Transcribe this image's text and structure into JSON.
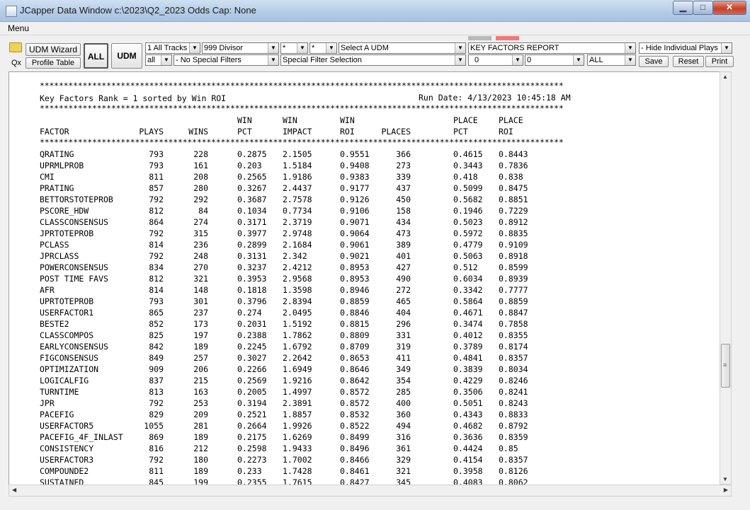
{
  "window": {
    "title": "JCapper Data Window c:\\2023\\Q2_2023 Odds Cap: None",
    "minimize": "▁",
    "maximize": "□",
    "close": "✕"
  },
  "menu": {
    "label": "Menu"
  },
  "toolbar": {
    "qx": "Qx",
    "udm_wizard": "UDM Wizard",
    "profile_table": "Profile Table",
    "all_button": "ALL",
    "udm_button": "UDM",
    "tracks": "1 All Tracks",
    "divisor": "999 Divisor",
    "star1": "*",
    "star2": "*",
    "select_udm": "Select A UDM",
    "report": "KEY FACTORS REPORT",
    "hide_plays": "- Hide Individual Plays",
    "all_lower": "all",
    "no_special": "- No Special Filters",
    "special_filter": "Special Filter Selection",
    "zero1": "0",
    "zero2": "0",
    "all_caps": "ALL",
    "save": "Save",
    "reset": "Reset",
    "print": "Print"
  },
  "report": {
    "stars": "**************************************************************************************************************",
    "heading": "Key Factors Rank = 1 sorted by Win ROI",
    "run_date": "Run Date: 4/13/2023 10:45:18 AM",
    "headers_top": [
      "",
      "",
      "",
      "WIN",
      "WIN",
      "WIN",
      "",
      "PLACE",
      "PLACE"
    ],
    "headers_bottom": [
      "FACTOR",
      "PLAYS",
      "WINS",
      "PCT",
      "IMPACT",
      "ROI",
      "PLACES",
      "PCT",
      "ROI"
    ],
    "rows": [
      [
        "QRATING",
        "793",
        "228",
        "0.2875",
        "2.1505",
        "0.9551",
        "366",
        "0.4615",
        "0.8443"
      ],
      [
        "UPRMLPROB",
        "793",
        "161",
        "0.203",
        "1.5184",
        "0.9408",
        "273",
        "0.3443",
        "0.7836"
      ],
      [
        "CMI",
        "811",
        "208",
        "0.2565",
        "1.9186",
        "0.9383",
        "339",
        "0.418",
        "0.838"
      ],
      [
        "PRATING",
        "857",
        "280",
        "0.3267",
        "2.4437",
        "0.9177",
        "437",
        "0.5099",
        "0.8475"
      ],
      [
        "BETTORSTOTEPROB",
        "792",
        "292",
        "0.3687",
        "2.7578",
        "0.9126",
        "450",
        "0.5682",
        "0.8851"
      ],
      [
        "PSCORE_HDW",
        "812",
        "84",
        "0.1034",
        "0.7734",
        "0.9106",
        "158",
        "0.1946",
        "0.7229"
      ],
      [
        "CLASSCONSENSUS",
        "864",
        "274",
        "0.3171",
        "2.3719",
        "0.9071",
        "434",
        "0.5023",
        "0.8912"
      ],
      [
        "JPRTOTEPROB",
        "792",
        "315",
        "0.3977",
        "2.9748",
        "0.9064",
        "473",
        "0.5972",
        "0.8835"
      ],
      [
        "PCLASS",
        "814",
        "236",
        "0.2899",
        "2.1684",
        "0.9061",
        "389",
        "0.4779",
        "0.9109"
      ],
      [
        "JPRCLASS",
        "792",
        "248",
        "0.3131",
        "2.342",
        "0.9021",
        "401",
        "0.5063",
        "0.8918"
      ],
      [
        "POWERCONSENSUS",
        "834",
        "270",
        "0.3237",
        "2.4212",
        "0.8953",
        "427",
        "0.512",
        "0.8599"
      ],
      [
        "POST TIME FAVS",
        "812",
        "321",
        "0.3953",
        "2.9568",
        "0.8953",
        "490",
        "0.6034",
        "0.8939"
      ],
      [
        "AFR",
        "814",
        "148",
        "0.1818",
        "1.3598",
        "0.8946",
        "272",
        "0.3342",
        "0.7777"
      ],
      [
        "UPRTOTEPROB",
        "793",
        "301",
        "0.3796",
        "2.8394",
        "0.8859",
        "465",
        "0.5864",
        "0.8859"
      ],
      [
        "USERFACTOR1",
        "865",
        "237",
        "0.274",
        "2.0495",
        "0.8846",
        "404",
        "0.4671",
        "0.8847"
      ],
      [
        "BESTE2",
        "852",
        "173",
        "0.2031",
        "1.5192",
        "0.8815",
        "296",
        "0.3474",
        "0.7858"
      ],
      [
        "CLASSCOMPOS",
        "825",
        "197",
        "0.2388",
        "1.7862",
        "0.8809",
        "331",
        "0.4012",
        "0.8355"
      ],
      [
        "EARLYCONSENSUS",
        "842",
        "189",
        "0.2245",
        "1.6792",
        "0.8709",
        "319",
        "0.3789",
        "0.8174"
      ],
      [
        "FIGCONSENSUS",
        "849",
        "257",
        "0.3027",
        "2.2642",
        "0.8653",
        "411",
        "0.4841",
        "0.8357"
      ],
      [
        "OPTIMIZATION",
        "909",
        "206",
        "0.2266",
        "1.6949",
        "0.8646",
        "349",
        "0.3839",
        "0.8034"
      ],
      [
        "LOGICALFIG",
        "837",
        "215",
        "0.2569",
        "1.9216",
        "0.8642",
        "354",
        "0.4229",
        "0.8246"
      ],
      [
        "TURNTIME",
        "813",
        "163",
        "0.2005",
        "1.4997",
        "0.8572",
        "285",
        "0.3506",
        "0.8241"
      ],
      [
        "JPR",
        "792",
        "253",
        "0.3194",
        "2.3891",
        "0.8572",
        "400",
        "0.5051",
        "0.8243"
      ],
      [
        "PACEFIG",
        "829",
        "209",
        "0.2521",
        "1.8857",
        "0.8532",
        "360",
        "0.4343",
        "0.8833"
      ],
      [
        "USERFACTOR5",
        "1055",
        "281",
        "0.2664",
        "1.9926",
        "0.8522",
        "494",
        "0.4682",
        "0.8792"
      ],
      [
        "PACEFIG_4F_INLAST",
        "869",
        "189",
        "0.2175",
        "1.6269",
        "0.8499",
        "316",
        "0.3636",
        "0.8359"
      ],
      [
        "CONSISTENCY",
        "816",
        "212",
        "0.2598",
        "1.9433",
        "0.8496",
        "361",
        "0.4424",
        "0.85"
      ],
      [
        "USERFACTOR3",
        "792",
        "180",
        "0.2273",
        "1.7002",
        "0.8466",
        "329",
        "0.4154",
        "0.8357"
      ],
      [
        "COMPOUNDE2",
        "811",
        "189",
        "0.233",
        "1.7428",
        "0.8461",
        "321",
        "0.3958",
        "0.8126"
      ],
      [
        "SUSTAINED",
        "845",
        "199",
        "0.2355",
        "1.7615",
        "0.8427",
        "345",
        "0.4083",
        "0.8062"
      ]
    ]
  },
  "colors": {
    "marker_gray": "#b9b9b9",
    "marker_red": "#f07878"
  }
}
